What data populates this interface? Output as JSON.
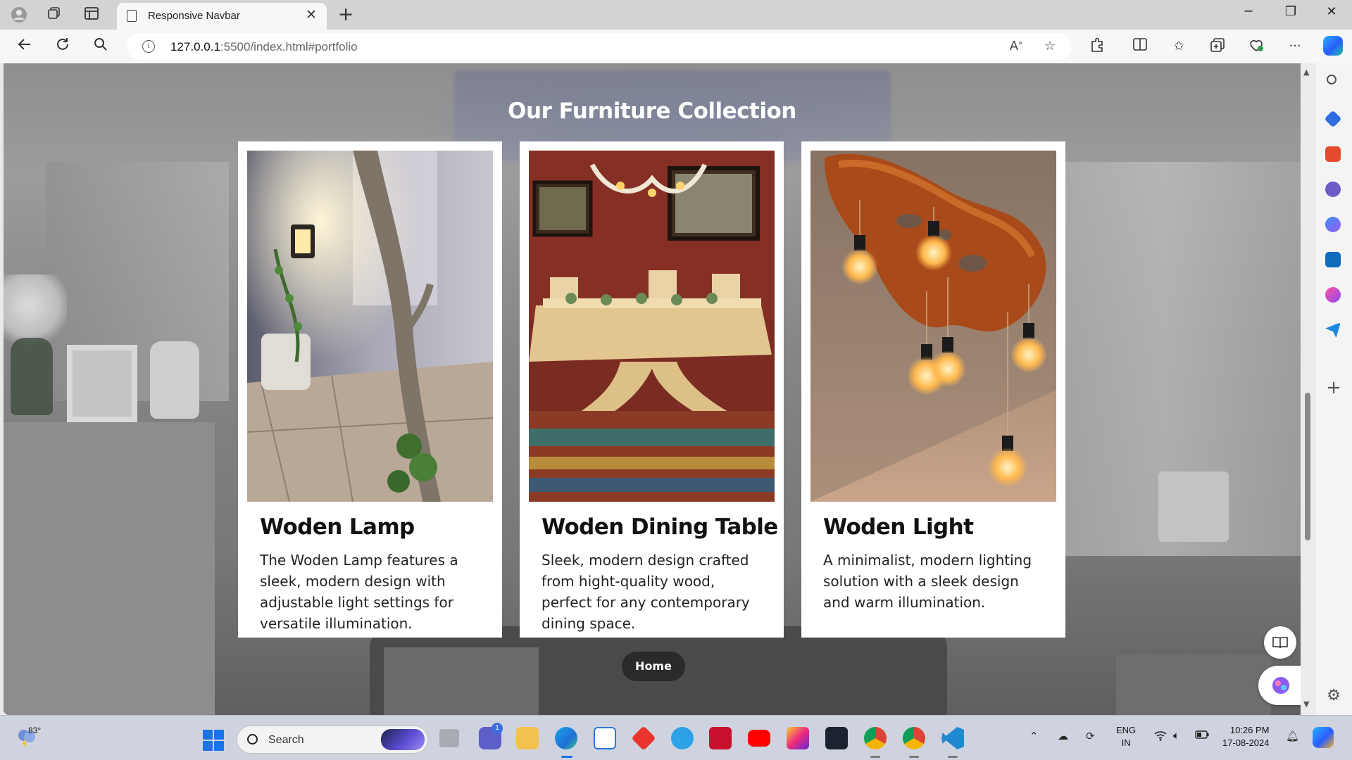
{
  "browser": {
    "tab_title": "Responsive Navbar",
    "tab_close": "✕",
    "new_tab": "+",
    "url_host": "127.0.0.1",
    "url_rest": ":5500/index.html#portfolio",
    "icons": [
      "profile-icon",
      "workspaces-icon",
      "tab-actions-icon",
      "back-icon",
      "refresh-icon",
      "search-icon",
      "site-info-icon",
      "read-aloud-icon",
      "favorite-star-icon",
      "extensions-icon",
      "split-screen-icon",
      "favorites-icon",
      "collections-icon",
      "browser-essentials-icon",
      "more-menu-icon",
      "copilot-icon"
    ],
    "window_controls": {
      "minimize": "─",
      "restore": "❐",
      "close": "✕"
    }
  },
  "page": {
    "section_title": "Our Furniture Collection",
    "cards": [
      {
        "title": "Woden Lamp",
        "description": "The Woden Lamp features a sleek, modern design with adjustable light settings for versatile illumination."
      },
      {
        "title": "Woden Dining Table",
        "description": "Sleek, modern design crafted from hight-quality wood, perfect for any contemporary dining space."
      },
      {
        "title": "Woden Light",
        "description": "A minimalist, modern lighting solution with a sleek design and warm illumination."
      }
    ],
    "home_button": "Home"
  },
  "taskbar": {
    "weather_temp": "83°",
    "search_placeholder": "Search",
    "tray_lang_1": "ENG",
    "tray_lang_2": "IN",
    "time": "10:26 PM",
    "date": "17-08-2024",
    "chat_badge": "1"
  },
  "colors": {
    "accent_blue": "#1a73e8",
    "card_bg": "#ffffff",
    "title_white": "#ffffff",
    "home_pill": "#2a2a2a"
  }
}
